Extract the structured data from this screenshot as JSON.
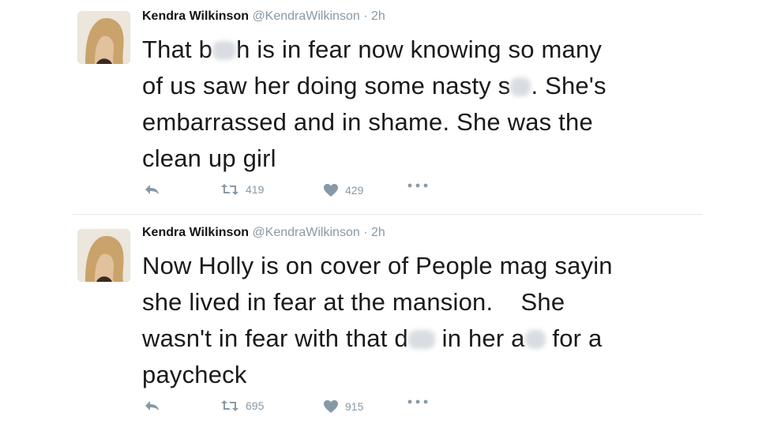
{
  "tweets": [
    {
      "author": "Kendra Wilkinson",
      "handle": "@KendraWilkinson",
      "separator": "·",
      "time": "2h",
      "lines": {
        "l1a": "That b",
        "l1b": "h is in fear now knowing so many",
        "l2a": "of us saw her doing some nasty s",
        "l2b": ". She's",
        "l3": "embarrassed and in shame. She was the",
        "l4": "clean up girl"
      },
      "retweets": "419",
      "likes": "429"
    },
    {
      "author": "Kendra Wilkinson",
      "handle": "@KendraWilkinson",
      "separator": "·",
      "time": "2h",
      "lines": {
        "l1": "Now Holly is on cover of People mag sayin",
        "l2": "she lived in fear at the mansion.    She",
        "l3a": "wasn't in fear with that d",
        "l3b": " in her a",
        "l3c": " for a",
        "l4": "paycheck"
      },
      "retweets": "695",
      "likes": "915"
    }
  ],
  "colors": {
    "text": "#1a1a1a",
    "meta": "#8899a6",
    "divider": "#e1e8ed"
  },
  "icons": [
    "reply-icon",
    "retweet-icon",
    "heart-icon",
    "more-icon"
  ]
}
